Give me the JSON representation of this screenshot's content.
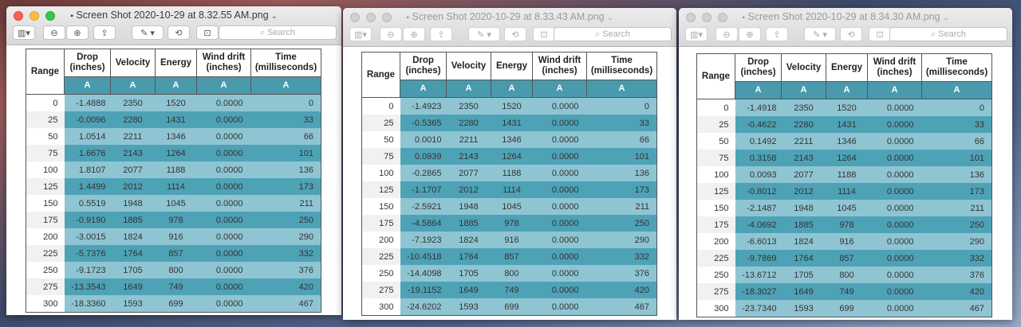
{
  "toolbar": {
    "search_placeholder": "Search"
  },
  "table": {
    "headers": [
      "Range",
      "Drop\n(inches)",
      "Velocity",
      "Energy",
      "Wind drift\n(inches)",
      "Time\n(milliseconds)"
    ],
    "subheader": [
      "A",
      "A",
      "A",
      "A",
      "A"
    ],
    "ranges": [
      "0",
      "25",
      "50",
      "75",
      "100",
      "125",
      "150",
      "175",
      "200",
      "225",
      "250",
      "275",
      "300"
    ],
    "velocity": [
      "2350",
      "2280",
      "2211",
      "2143",
      "2077",
      "2012",
      "1948",
      "1885",
      "1824",
      "1764",
      "1705",
      "1649",
      "1593"
    ],
    "energy": [
      "1520",
      "1431",
      "1346",
      "1264",
      "1188",
      "1114",
      "1045",
      "978",
      "916",
      "857",
      "800",
      "749",
      "699"
    ],
    "wind": [
      "0.0000",
      "0.0000",
      "0.0000",
      "0.0000",
      "0.0000",
      "0.0000",
      "0.0000",
      "0.0000",
      "0.0000",
      "0.0000",
      "0.0000",
      "0.0000",
      "0.0000"
    ],
    "time": [
      "0",
      "33",
      "66",
      "101",
      "136",
      "173",
      "211",
      "250",
      "290",
      "332",
      "376",
      "420",
      "467"
    ]
  },
  "windows": [
    {
      "title": "Screen Shot 2020-10-29 at 8.32.55 AM.png",
      "drop": [
        "-1.4888",
        "-0.0096",
        "1.0514",
        "1.6676",
        "1.8107",
        "1.4499",
        "0.5519",
        "-0.9190",
        "-3.0015",
        "-5.7376",
        "-9.1723",
        "-13.3543",
        "-18.3360"
      ]
    },
    {
      "title": "Screen Shot 2020-10-29 at 8.33.43 AM.png",
      "drop": [
        "-1.4923",
        "-0.5365",
        "0.0010",
        "0.0939",
        "-0.2865",
        "-1.1707",
        "-2.5921",
        "-4.5864",
        "-7.1923",
        "-10.4518",
        "-14.4098",
        "-19.1152",
        "-24.6202"
      ]
    },
    {
      "title": "Screen Shot 2020-10-29 at 8.34.30 AM.png",
      "drop": [
        "-1.4918",
        "-0.4622",
        "0.1492",
        "0.3158",
        "0.0093",
        "-0.8012",
        "-2.1487",
        "-4.0692",
        "-6.6013",
        "-9.7869",
        "-13.6712",
        "-18.3027",
        "-23.7340"
      ]
    }
  ]
}
